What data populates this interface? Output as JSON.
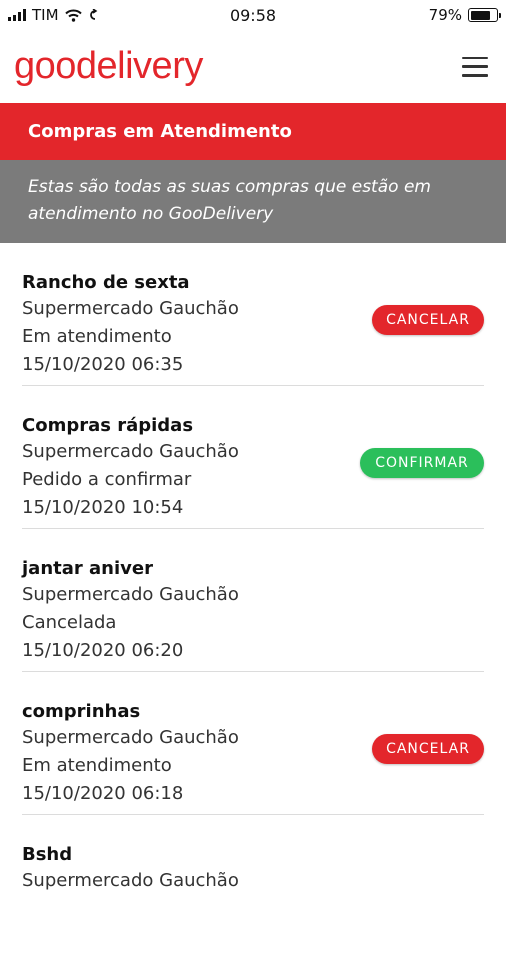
{
  "status_bar": {
    "carrier": "TIM",
    "time": "09:58",
    "battery_percent": "79%",
    "battery_level": 0.79
  },
  "header": {
    "logo": "goodelivery",
    "menu_icon": "hamburger-menu-icon"
  },
  "section": {
    "title": "Compras em Atendimento",
    "description": "Estas são todas as suas compras que estão em atendimento no GooDelivery"
  },
  "orders": [
    {
      "name": "Rancho de sexta",
      "store": "Supermercado Gauchão",
      "status": "Em atendimento",
      "date": "15/10/2020 06:35",
      "action": "CANCELAR"
    },
    {
      "name": "Compras rápidas",
      "store": "Supermercado Gauchão",
      "status": "Pedido a confirmar",
      "date": "15/10/2020 10:54",
      "action": "CONFIRMAR"
    },
    {
      "name": "jantar aniver",
      "store": "Supermercado Gauchão",
      "status": "Cancelada",
      "date": "15/10/2020 06:20",
      "action": ""
    },
    {
      "name": "comprinhas",
      "store": "Supermercado Gauchão",
      "status": "Em atendimento",
      "date": "15/10/2020 06:18",
      "action": "CANCELAR"
    },
    {
      "name": "Bshd",
      "store": "Supermercado Gauchão",
      "status": "",
      "date": "",
      "action": ""
    }
  ],
  "colors": {
    "brand_red": "#e3262b",
    "confirm_green": "#2bbf5b",
    "banner_gray": "#7b7b7b"
  }
}
